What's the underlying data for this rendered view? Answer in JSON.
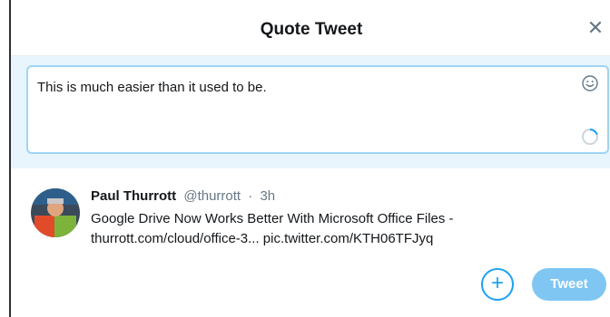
{
  "dialog": {
    "title": "Quote Tweet",
    "close_glyph": "✕"
  },
  "composer": {
    "text": "This is much easier than it used to be.",
    "emoji_icon": "smiley-icon",
    "progress_icon": "character-count-ring-icon"
  },
  "quoted_tweet": {
    "author": "Paul Thurrott",
    "handle": "@thurrott",
    "separator": "·",
    "time": "3h",
    "line1": "Google Drive Now Works Better With Microsoft Office Files -",
    "line2": "thurrott.com/cloud/office-3... pic.twitter.com/KTH06TFJyq"
  },
  "actions": {
    "add_glyph": "+",
    "tweet_label": "Tweet"
  },
  "colors": {
    "accent": "#1da1f2",
    "tweet_button": "#7fc6f3",
    "composer_bg": "#e8f5fd",
    "input_border": "#9fd4f4"
  }
}
